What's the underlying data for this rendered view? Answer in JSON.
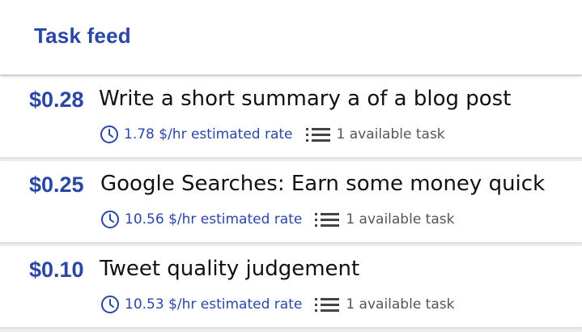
{
  "header": {
    "title": "Task feed"
  },
  "colors": {
    "accent": "#2a47a8",
    "text": "#111111",
    "muted": "#555555",
    "background": "#ececec"
  },
  "tasks": [
    {
      "price": "$0.28",
      "title": "Write a short summary a of a blog post",
      "rate": "1.78 $/hr estimated rate",
      "available": "1 available task",
      "rate_icon": "clock-icon",
      "available_icon": "list-icon"
    },
    {
      "price": "$0.25",
      "title": "Google Searches: Earn some money quick",
      "rate": "10.56 $/hr estimated rate",
      "available": "1 available task",
      "rate_icon": "clock-icon",
      "available_icon": "list-icon"
    },
    {
      "price": "$0.10",
      "title": "Tweet quality judgement",
      "rate": "10.53 $/hr estimated rate",
      "available": "1 available task",
      "rate_icon": "clock-icon",
      "available_icon": "list-icon"
    }
  ]
}
